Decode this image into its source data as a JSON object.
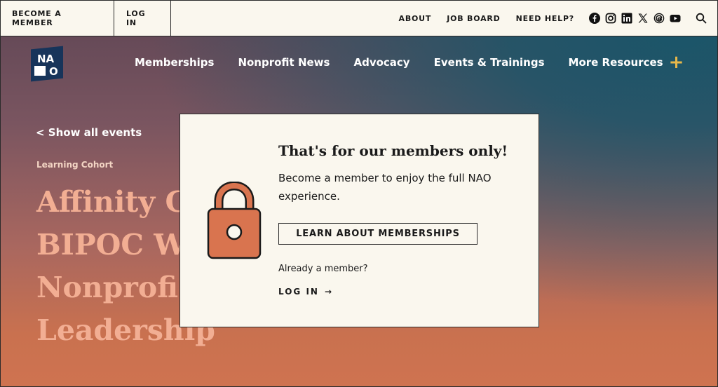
{
  "topbar": {
    "become_member": "BECOME A MEMBER",
    "log_in": "LOG IN",
    "links": [
      "ABOUT",
      "JOB BOARD",
      "NEED HELP?"
    ],
    "social_icons": [
      "facebook-icon",
      "instagram-icon",
      "linkedin-icon",
      "x-icon",
      "threads-icon",
      "youtube-icon"
    ]
  },
  "logo": {
    "top": "NA",
    "bottom": "O"
  },
  "nav": {
    "items": [
      "Memberships",
      "Nonprofit News",
      "Advocacy",
      "Events & Trainings",
      "More Resources"
    ],
    "more_icon": "+"
  },
  "page": {
    "back": "< Show all events",
    "eyebrow": "Learning Cohort",
    "title_lines": [
      "Affinity C",
      "BIPOC We",
      "Nonprofi",
      "Leadership"
    ]
  },
  "modal": {
    "title": "That's for our members only!",
    "text": "Become a member to enjoy the full NAO experience.",
    "button": "LEARN ABOUT MEMBERSHIPS",
    "already": "Already a member?",
    "login": "LOG IN",
    "login_arrow": "→"
  },
  "colors": {
    "cream": "#faf7ee",
    "navy": "#17345a",
    "accent_gold": "#e8b84a",
    "lock_orange": "#d9744f",
    "title_peach": "#f2ae93"
  }
}
